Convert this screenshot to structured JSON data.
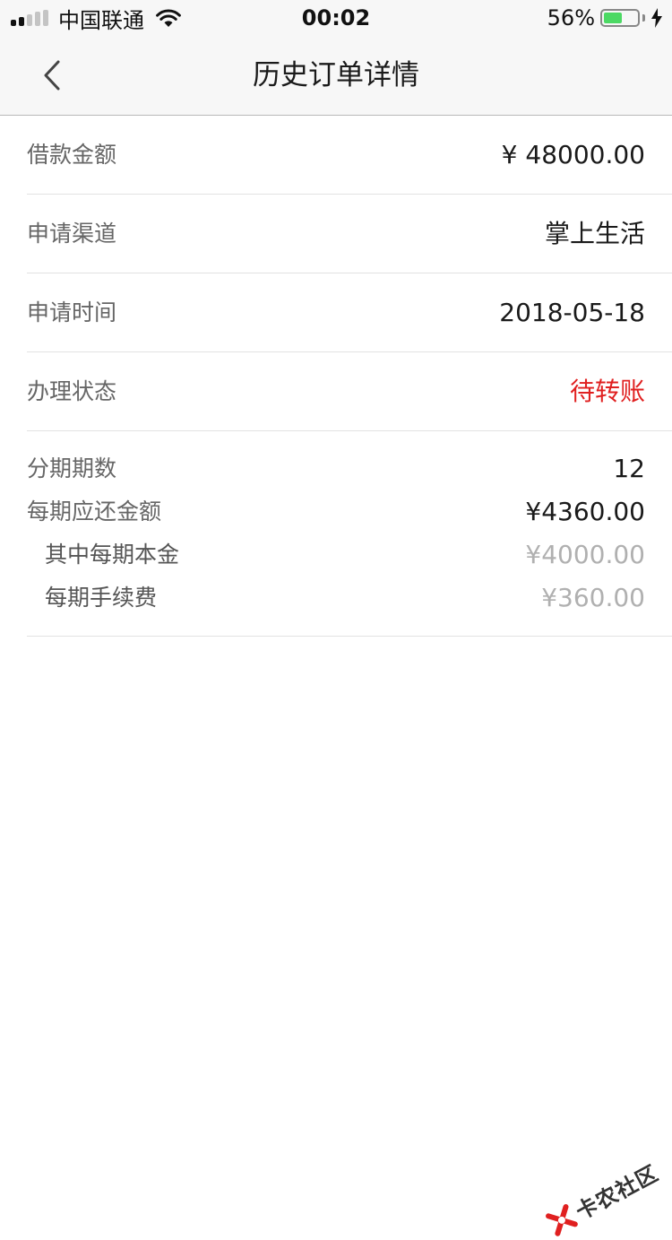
{
  "status_bar": {
    "carrier": "中国联通",
    "time": "00:02",
    "battery_percent": "56%",
    "battery_level": 0.56,
    "signal_bars_total": 5,
    "signal_bars_active": 2
  },
  "nav": {
    "back_icon": "chevron-left-icon",
    "title": "历史订单详情"
  },
  "details": [
    {
      "label": "借款金额",
      "value": "¥ 48000.00"
    },
    {
      "label": "申请渠道",
      "value": "掌上生活"
    },
    {
      "label": "申请时间",
      "value": "2018-05-18"
    },
    {
      "label": "办理状态",
      "value": "待转账"
    }
  ],
  "installment": {
    "periods_label": "分期期数",
    "periods_value": "12",
    "per_period_label": "每期应还金额",
    "per_period_value": "¥4360.00",
    "principal_label": "其中每期本金",
    "principal_value": "¥4000.00",
    "fee_label": "每期手续费",
    "fee_value": "¥360.00"
  },
  "watermark": {
    "text": "卡农社区"
  },
  "colors": {
    "status_red": "#e02020",
    "muted_value": "#b0b0b0",
    "label_gray": "#666666",
    "bar_background": "#f7f7f7",
    "battery_green": "#4cd964"
  }
}
